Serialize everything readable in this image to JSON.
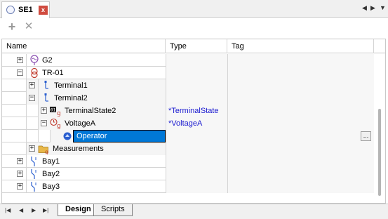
{
  "document_tab": {
    "title": "SE1",
    "close_glyph": "x",
    "icon": "circle-icon"
  },
  "strip_nav": {
    "prev": "◀",
    "next": "▶",
    "menu": "▼"
  },
  "toolbar": {
    "add_glyph": "+",
    "delete_glyph": "✕"
  },
  "grid": {
    "columns": {
      "name": "Name",
      "type": "Type",
      "tag": "Tag"
    },
    "rows": [
      {
        "label": "G2",
        "type": "",
        "expander": "+",
        "icon": "generator-icon"
      },
      {
        "label": "TR-01",
        "type": "",
        "expander": "−",
        "icon": "transformer-icon"
      },
      {
        "label": "Terminal1",
        "type": "",
        "expander": "+",
        "icon": "terminal-icon"
      },
      {
        "label": "Terminal2",
        "type": "",
        "expander": "−",
        "icon": "terminal-icon"
      },
      {
        "label": "TerminalState2",
        "type": "*TerminalState",
        "expander": "+",
        "icon": "state-icon"
      },
      {
        "label": "VoltageA",
        "type": "*VoltageA",
        "expander": "−",
        "icon": "voltage-icon"
      },
      {
        "label": "Operator",
        "type": "",
        "expander": "",
        "icon": "operator-icon",
        "selected": true,
        "ellipsis": "..."
      },
      {
        "label": "Measurements",
        "type": "",
        "expander": "+",
        "icon": "folder-icon"
      },
      {
        "label": "Bay1",
        "type": "",
        "expander": "+",
        "icon": "bay-icon"
      },
      {
        "label": "Bay2",
        "type": "",
        "expander": "+",
        "icon": "bay-icon"
      },
      {
        "label": "Bay3",
        "type": "",
        "expander": "+",
        "icon": "bay-icon"
      }
    ]
  },
  "sheet_nav": {
    "first": "|◀",
    "prev": "◀",
    "next": "▶",
    "last": "▶|"
  },
  "sheet_tabs": {
    "design": "Design",
    "scripts": "Scripts"
  },
  "colors": {
    "accent": "#0078d7",
    "type_text": "#1a1ad0",
    "close": "#d04b3f"
  }
}
